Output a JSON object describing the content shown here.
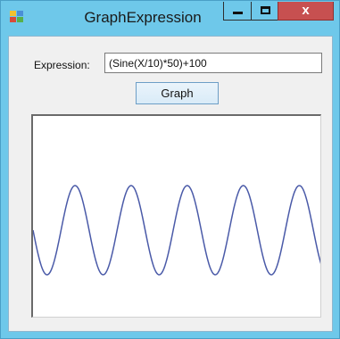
{
  "window": {
    "title": "GraphExpression",
    "close_glyph": "x",
    "icons": {
      "app": "app-window-icon",
      "minimize": "minimize-icon",
      "maximize": "maximize-icon",
      "close": "close-icon"
    }
  },
  "form": {
    "expression_label": "Expression:",
    "expression_value": "(Sine(X/10)*50)+100",
    "graph_button_label": "Graph"
  },
  "chart_data": {
    "type": "line",
    "expression": "(Sine(X/10)*50)+100",
    "x_range": [
      0,
      324
    ],
    "y_range": [
      0,
      228
    ],
    "y_axis_inverted": true,
    "line_color": "#4a5aa8"
  }
}
